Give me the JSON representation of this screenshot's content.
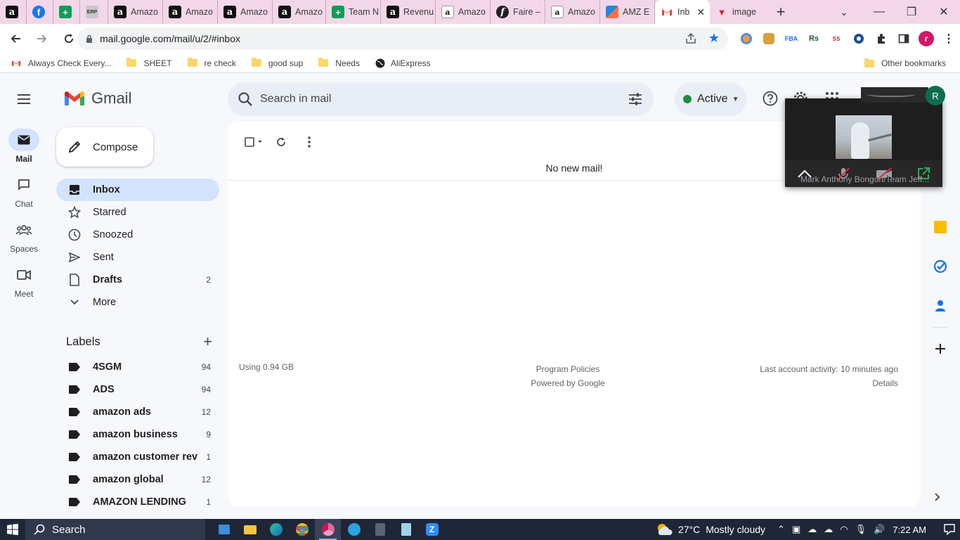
{
  "browser": {
    "tabs": [
      {
        "title": "",
        "icon": "amazon-icon"
      },
      {
        "title": "",
        "icon": "facebook-icon"
      },
      {
        "title": "",
        "icon": "sheets-icon"
      },
      {
        "title": "",
        "icon": "erp-icon"
      },
      {
        "title": "Amazo",
        "icon": "amazon-icon"
      },
      {
        "title": "Amazo",
        "icon": "amazon-icon"
      },
      {
        "title": "Amazo",
        "icon": "amazon-icon"
      },
      {
        "title": "Amazo",
        "icon": "amazon-icon"
      },
      {
        "title": "Team N",
        "icon": "sheets-icon"
      },
      {
        "title": "Revenu",
        "icon": "amazon-icon"
      },
      {
        "title": "Amazo",
        "icon": "amazon-smile-icon"
      },
      {
        "title": "Faire –",
        "icon": "faire-icon"
      },
      {
        "title": "Amazo",
        "icon": "amazon-smile-icon"
      },
      {
        "title": "AMZ E",
        "icon": "amz-icon"
      },
      {
        "title": "Inb",
        "icon": "gmail-icon",
        "active": true
      },
      {
        "title": "image",
        "icon": "image-icon"
      }
    ],
    "url": "mail.google.com/mail/u/2/#inbox",
    "profile_initial": "r",
    "bookmarks": [
      "Always Check Every...",
      "SHEET",
      "re check",
      "good sup",
      "Needs",
      "AliExpress"
    ],
    "other_bookmarks": "Other bookmarks"
  },
  "gmail": {
    "product_name": "Gmail",
    "search_placeholder": "Search in mail",
    "status": "Active",
    "status_color": "#1e8e3e",
    "compose": "Compose",
    "rail": [
      {
        "label": "Mail",
        "icon": "mail-icon"
      },
      {
        "label": "Chat",
        "icon": "chat-icon"
      },
      {
        "label": "Spaces",
        "icon": "spaces-icon"
      },
      {
        "label": "Meet",
        "icon": "meet-icon"
      }
    ],
    "nav": [
      {
        "label": "Inbox",
        "count": ""
      },
      {
        "label": "Starred",
        "count": ""
      },
      {
        "label": "Snoozed",
        "count": ""
      },
      {
        "label": "Sent",
        "count": ""
      },
      {
        "label": "Drafts",
        "count": "2"
      },
      {
        "label": "More",
        "count": ""
      }
    ],
    "labels_title": "Labels",
    "labels": [
      {
        "name": "4SGM",
        "count": "94"
      },
      {
        "name": "ADS",
        "count": "94"
      },
      {
        "name": "amazon ads",
        "count": "12"
      },
      {
        "name": "amazon business",
        "count": "9"
      },
      {
        "name": "amazon customer rev",
        "count": "1"
      },
      {
        "name": "amazon global",
        "count": "12"
      },
      {
        "name": "AMAZON LENDING",
        "count": "1"
      }
    ],
    "empty_message": "No new mail!",
    "footer": {
      "storage": "Using 0.94 GB",
      "policies": "Program Policies",
      "powered": "Powered by Google",
      "activity": "Last account activity: 10 minutes ago",
      "details": "Details"
    },
    "avatar_initial": "R"
  },
  "video_overlay": {
    "participant": "Mark Anthony Bongon/Team Jeff..."
  },
  "taskbar": {
    "search": "Search",
    "temperature": "27°C",
    "weather": "Mostly cloudy",
    "time": "7:22 AM"
  }
}
